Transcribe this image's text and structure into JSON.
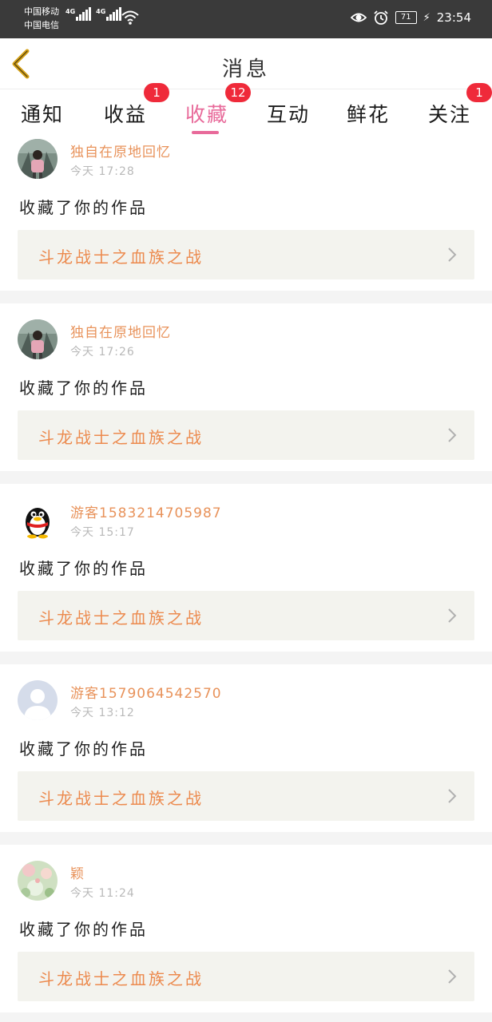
{
  "status_bar": {
    "carrier_1": "中国移动",
    "carrier_2": "中国电信",
    "network_1": "4G",
    "network_2": "4G",
    "battery": "71",
    "time": "23:54"
  },
  "nav": {
    "title": "消息",
    "back_icon": "back-chevron-icon"
  },
  "tabs": [
    {
      "label": "通知",
      "badge": ""
    },
    {
      "label": "收益",
      "badge": "1"
    },
    {
      "label": "收藏",
      "badge": "12"
    },
    {
      "label": "互动",
      "badge": ""
    },
    {
      "label": "鲜花",
      "badge": ""
    },
    {
      "label": "关注",
      "badge": "1"
    }
  ],
  "active_tab": "收藏",
  "colors": {
    "accent": "#e86a9a",
    "username": "#e8925a",
    "work_title": "#ec8a4e",
    "badge": "#ef2a3a",
    "status_bar": "#3a3a3a"
  },
  "notifications": [
    {
      "user": "独自在原地回忆",
      "time": "今天 17:28",
      "action": "收藏了你的作品",
      "work": "斗龙战士之血族之战",
      "avatar": "photo-avatar"
    },
    {
      "user": "独自在原地回忆",
      "time": "今天 17:26",
      "action": "收藏了你的作品",
      "work": "斗龙战士之血族之战",
      "avatar": "photo-avatar"
    },
    {
      "user": "游客15832147059​87",
      "time": "今天 15:17",
      "action": "收藏了你的作品",
      "work": "斗龙战士之血族之战",
      "avatar": "penguin-avatar"
    },
    {
      "user": "游客15790645425​70",
      "time": "今天 13:12",
      "action": "收藏了你的作品",
      "work": "斗龙战士之血族之战",
      "avatar": "default-user-avatar"
    },
    {
      "user": "颖",
      "time": "今天 11:24",
      "action": "收藏了你的作品",
      "work": "斗龙战士之血族之战",
      "avatar": "flower-avatar"
    }
  ]
}
